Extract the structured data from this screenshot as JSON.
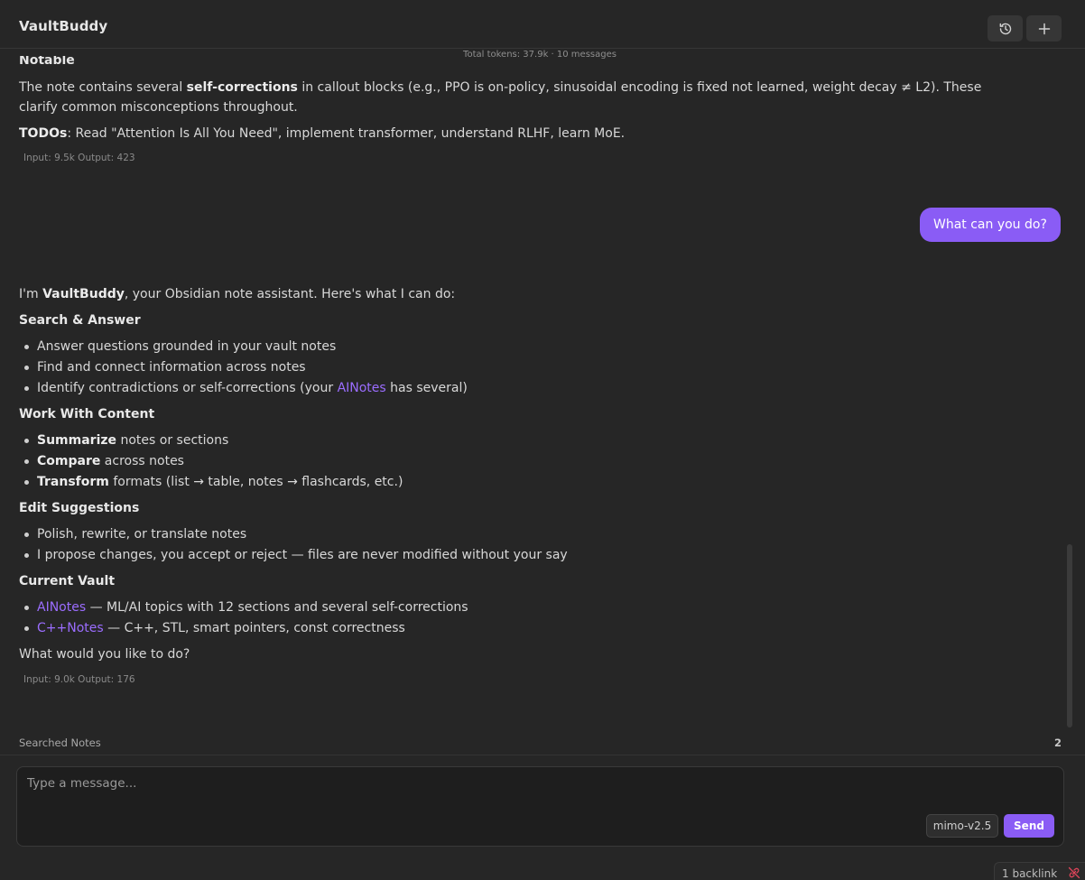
{
  "header": {
    "title": "VaultBuddy",
    "history_icon": "history-icon",
    "new_chat_icon": "plus-icon",
    "total_tokens": "Total tokens: 37.9k · 10 messages"
  },
  "messages": {
    "prev_assistant": {
      "cut_heading": "Notable",
      "notable_before": "The note contains several ",
      "notable_bold": "self-corrections",
      "notable_after": " in callout blocks (e.g., PPO is on-policy, sinusoidal encoding is fixed not learned, weight decay ≠ L2). These clarify common misconceptions throughout.",
      "todos_bold": "TODOs",
      "todos_rest": ": Read \"Attention Is All You Need\", implement transformer, understand RLHF, learn MoE.",
      "meta": "Input: 9.5k Output: 423"
    },
    "user": {
      "text": "What can you do?"
    },
    "assistant": {
      "intro_before": "I'm ",
      "intro_bold": "VaultBuddy",
      "intro_after": ", your Obsidian note assistant. Here's what I can do:",
      "search_heading": "Search & Answer",
      "search_items": [
        "Answer questions grounded in your vault notes",
        "Find and connect information across notes",
        "Identify contradictions or self-corrections (your "
      ],
      "search_item3_link": "AINotes",
      "search_item3_after": " has several)",
      "work_heading": "Work With Content",
      "work_items": [
        {
          "bold": "Summarize",
          "rest": " notes or sections"
        },
        {
          "bold": "Compare",
          "rest": " across notes"
        },
        {
          "bold": "Transform",
          "rest": " formats (list → table, notes → flashcards, etc.)"
        }
      ],
      "edit_heading": "Edit Suggestions",
      "edit_items": [
        "Polish, rewrite, or translate notes",
        "I propose changes, you accept or reject — files are never modified without your say"
      ],
      "vault_heading": "Current Vault",
      "vault_items": [
        {
          "link": "AINotes",
          "rest": " — ML/AI topics with 12 sections and several self-corrections"
        },
        {
          "link": "C++Notes",
          "rest": " — C++, STL, smart pointers, const correctness"
        }
      ],
      "closing": "What would you like to do?",
      "meta": "Input: 9.0k Output: 176"
    }
  },
  "searched_notes": {
    "label": "Searched Notes",
    "count": "2"
  },
  "composer": {
    "placeholder": "Type a message...",
    "model": "mimo-v2.5",
    "send_label": "Send"
  },
  "statusbar": {
    "backlinks": "1 backlink",
    "icon": "unlinked-icon"
  },
  "colors": {
    "accent": "#8a5cf5",
    "link": "#9b6dff",
    "background": "#262626"
  }
}
